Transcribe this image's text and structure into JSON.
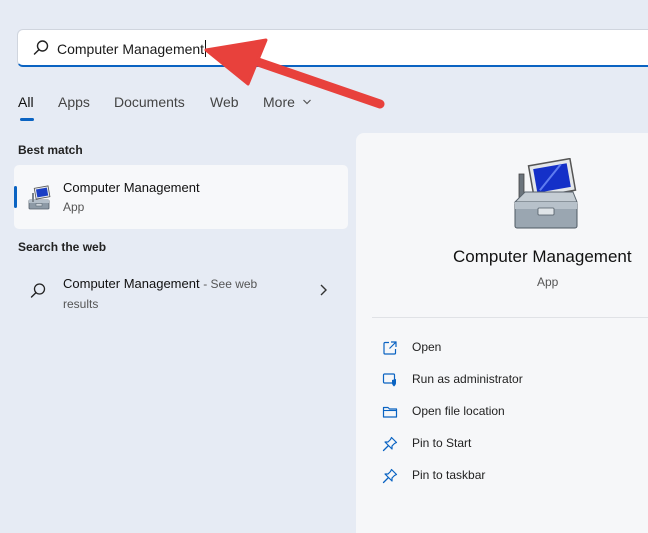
{
  "search": {
    "query": "Computer Management"
  },
  "tabs": [
    {
      "label": "All",
      "active": true
    },
    {
      "label": "Apps"
    },
    {
      "label": "Documents"
    },
    {
      "label": "Web"
    },
    {
      "label": "More"
    }
  ],
  "best_match": {
    "heading": "Best match",
    "title": "Computer Management",
    "type": "App"
  },
  "search_web": {
    "heading": "Search the web",
    "query": "Computer Management",
    "hint": "- See web results"
  },
  "detail": {
    "title": "Computer Management",
    "type": "App",
    "actions": [
      {
        "label": "Open",
        "icon": "open-external-icon"
      },
      {
        "label": "Run as administrator",
        "icon": "shield-admin-icon"
      },
      {
        "label": "Open file location",
        "icon": "folder-icon"
      },
      {
        "label": "Pin to Start",
        "icon": "pin-icon"
      },
      {
        "label": "Pin to taskbar",
        "icon": "pin-icon"
      }
    ]
  },
  "colors": {
    "accent": "#0a63c2",
    "annotation_arrow": "#e8413c",
    "background": "#e6ebf4"
  }
}
